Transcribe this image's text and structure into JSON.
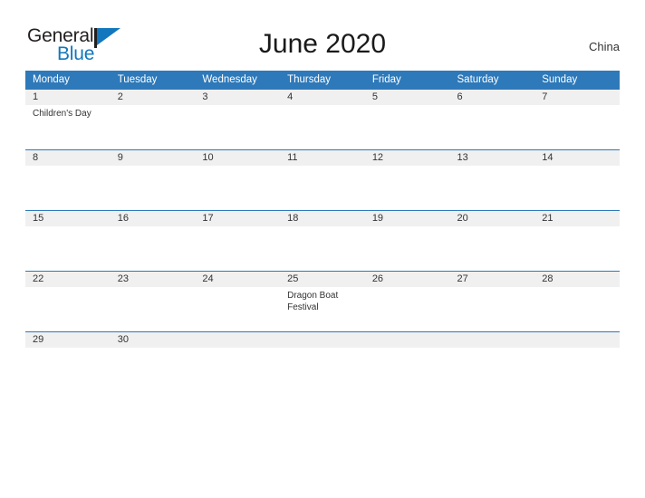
{
  "brand": {
    "name_part1": "General",
    "name_part2": "Blue",
    "flag_icon": "flag-triangle-icon"
  },
  "header": {
    "title": "June 2020",
    "country": "China"
  },
  "calendar": {
    "weekday_headers": [
      "Monday",
      "Tuesday",
      "Wednesday",
      "Thursday",
      "Friday",
      "Saturday",
      "Sunday"
    ],
    "header_bg_color": "#2e79b9",
    "daynum_bg_color": "#f0f0f0",
    "row_border_color": "#2e79b9",
    "weeks": [
      {
        "days": [
          {
            "num": "1",
            "event": "Children's Day"
          },
          {
            "num": "2",
            "event": ""
          },
          {
            "num": "3",
            "event": ""
          },
          {
            "num": "4",
            "event": ""
          },
          {
            "num": "5",
            "event": ""
          },
          {
            "num": "6",
            "event": ""
          },
          {
            "num": "7",
            "event": ""
          }
        ]
      },
      {
        "days": [
          {
            "num": "8",
            "event": ""
          },
          {
            "num": "9",
            "event": ""
          },
          {
            "num": "10",
            "event": ""
          },
          {
            "num": "11",
            "event": ""
          },
          {
            "num": "12",
            "event": ""
          },
          {
            "num": "13",
            "event": ""
          },
          {
            "num": "14",
            "event": ""
          }
        ]
      },
      {
        "days": [
          {
            "num": "15",
            "event": ""
          },
          {
            "num": "16",
            "event": ""
          },
          {
            "num": "17",
            "event": ""
          },
          {
            "num": "18",
            "event": ""
          },
          {
            "num": "19",
            "event": ""
          },
          {
            "num": "20",
            "event": ""
          },
          {
            "num": "21",
            "event": ""
          }
        ]
      },
      {
        "days": [
          {
            "num": "22",
            "event": ""
          },
          {
            "num": "23",
            "event": ""
          },
          {
            "num": "24",
            "event": ""
          },
          {
            "num": "25",
            "event": "Dragon Boat Festival"
          },
          {
            "num": "26",
            "event": ""
          },
          {
            "num": "27",
            "event": ""
          },
          {
            "num": "28",
            "event": ""
          }
        ]
      },
      {
        "days": [
          {
            "num": "29",
            "event": ""
          },
          {
            "num": "30",
            "event": ""
          },
          {
            "num": "",
            "event": ""
          },
          {
            "num": "",
            "event": ""
          },
          {
            "num": "",
            "event": ""
          },
          {
            "num": "",
            "event": ""
          },
          {
            "num": "",
            "event": ""
          }
        ]
      }
    ]
  }
}
